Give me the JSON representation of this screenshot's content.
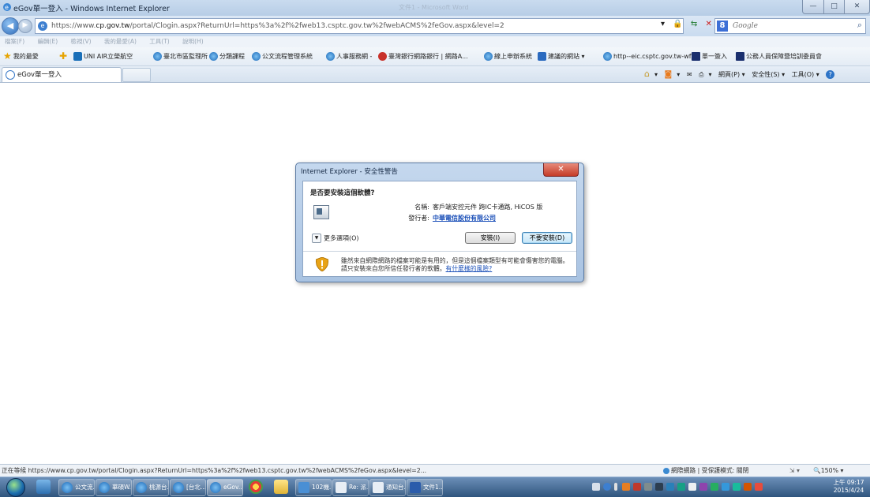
{
  "window": {
    "title": "eGov單一登入 - Windows Internet Explorer",
    "ghost_title": "文件1 - Microsoft Word",
    "min_label": "—",
    "max_label": "□",
    "close_label": "✕"
  },
  "address": {
    "url_prefix": "https://www.",
    "url_domain": "cp.gov.tw",
    "url_rest": "/portal/Clogin.aspx?ReturnUrl=https%3a%2f%2fweb13.csptc.gov.tw%2fwebACMS%2feGov.aspx&level=2",
    "search_placeholder": "Google"
  },
  "menu": [
    "檔案(F)",
    "編輯(E)",
    "檢視(V)",
    "我的最愛(A)",
    "工具(T)",
    "說明(H)"
  ],
  "favorites": [
    {
      "label": "我的最愛",
      "icon": "star-icon"
    },
    {
      "label": "UNI AIR立榮航空",
      "icon": "uniair-icon"
    },
    {
      "label": "臺北市區監理所",
      "icon": "ie-page-icon"
    },
    {
      "label": "分類課程",
      "icon": "ie-page-icon"
    },
    {
      "label": "公文流程管理系統",
      "icon": "ie-page-icon"
    },
    {
      "label": "人事服務網 -",
      "icon": "hr-icon"
    },
    {
      "label": "臺灣銀行網路銀行 | 網路A...",
      "icon": "bank-icon"
    },
    {
      "label": "線上申辦系統",
      "icon": "ie-page-icon"
    },
    {
      "label": "建議的網站 ▾",
      "icon": "suggested-sites-icon"
    },
    {
      "label": "http--eic.csptc.gov.tw-wf...",
      "icon": "ie-page-icon"
    },
    {
      "label": "單一簽入",
      "icon": "gov-icon"
    },
    {
      "label": "公務人員保障暨培訓委員會",
      "icon": "gov-icon"
    }
  ],
  "tab": {
    "label": "eGov單一登入"
  },
  "commandbar": {
    "page": "網頁(P) ▾",
    "safety": "安全性(S) ▾",
    "tools": "工具(O) ▾"
  },
  "dialog": {
    "title": "Internet Explorer - 安全性警告",
    "close_label": "✕",
    "question": "是否要安裝這個軟體?",
    "name_label": "名稱:",
    "name_value": "客戶端安控元件 跨IC卡通路, HiCOS 版",
    "publisher_label": "發行者:",
    "publisher_value": "中華電信股份有限公司",
    "more_options": "更多選項(O)",
    "install_button": "安裝(I)",
    "dont_install_button": "不要安裝(D)",
    "warning_text": "雖然來自網際網路的檔案可能是有用的，但是這個檔案類型有可能會傷害您的電腦。請只安裝來自您所信任發行者的軟體。",
    "risk_link": "有什麼樣的風險?"
  },
  "status": {
    "text": "正在等候 https://www.cp.gov.tw/portal/Clogin.aspx?ReturnUrl=https%3a%2f%2fweb13.csptc.gov.tw%2fwebACMS%2feGov.aspx&level=2...",
    "zone": "網際網路 | 受保護模式: 關閉",
    "zoom": "150%"
  },
  "taskbar": {
    "items": [
      {
        "label": "公文流..."
      },
      {
        "label": "華碩W..."
      },
      {
        "label": "桃源台..."
      },
      {
        "label": "[台北..."
      },
      {
        "label": "eGov..."
      },
      {
        "label": "102機..."
      },
      {
        "label": "Re: 派..."
      },
      {
        "label": "通知台..."
      },
      {
        "label": "文件1..."
      }
    ],
    "time": "上午 09:17",
    "date": "2015/4/24"
  }
}
